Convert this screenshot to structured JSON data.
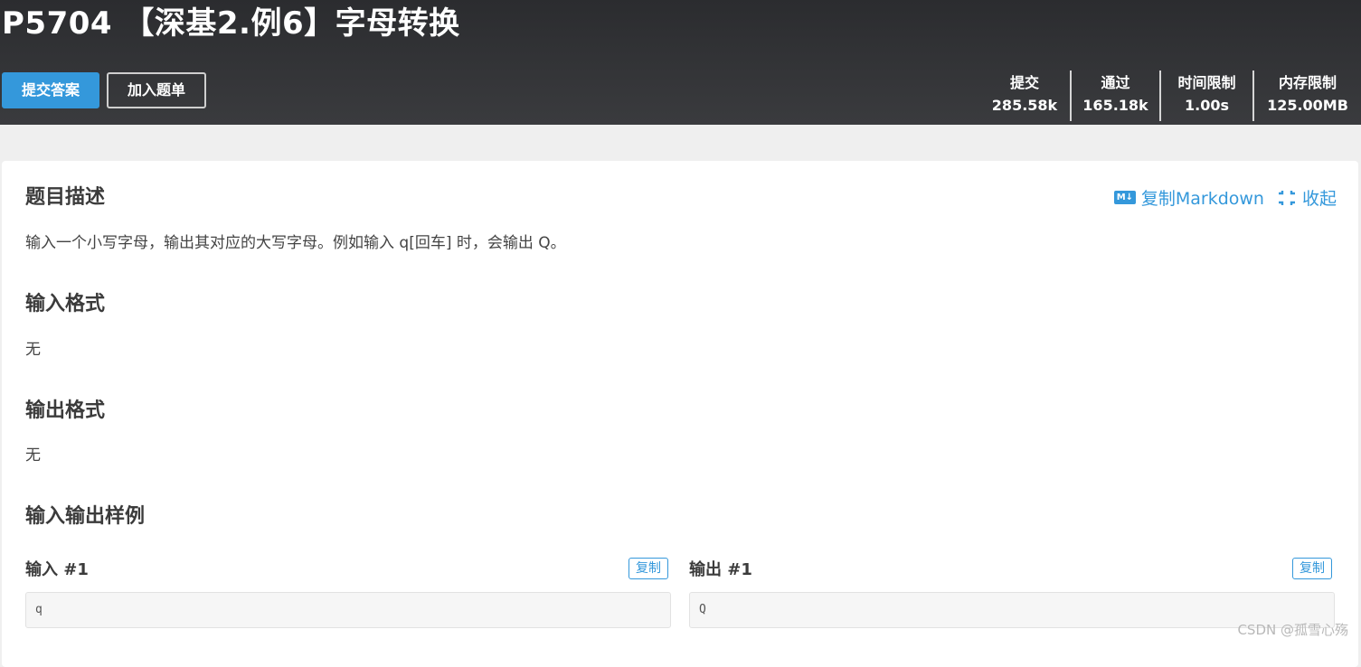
{
  "header": {
    "title": "P5704 【深基2.例6】字母转换",
    "submit_label": "提交答案",
    "add_label": "加入题单",
    "stats": [
      {
        "key": "提交",
        "value": "285.58k"
      },
      {
        "key": "通过",
        "value": "165.18k"
      },
      {
        "key": "时间限制",
        "value": "1.00s"
      },
      {
        "key": "内存限制",
        "value": "125.00MB"
      }
    ]
  },
  "tools": {
    "md_icon_text": "M↓",
    "copy_markdown": "复制Markdown",
    "collapse": "收起"
  },
  "sections": {
    "description": {
      "title": "题目描述",
      "body": "输入一个小写字母，输出其对应的大写字母。例如输入 q[回车] 时，会输出 Q。"
    },
    "input_format": {
      "title": "输入格式",
      "body": "无"
    },
    "output_format": {
      "title": "输出格式",
      "body": "无"
    },
    "samples": {
      "title": "输入输出样例"
    }
  },
  "samples": [
    {
      "input_label": "输入 #1",
      "input": "q",
      "output_label": "输出 #1",
      "output": "Q",
      "copy_label": "复制"
    }
  ],
  "watermark": "CSDN @孤雪心殇",
  "colors": {
    "accent": "#3498db",
    "header_bg": "#2e2f32"
  }
}
